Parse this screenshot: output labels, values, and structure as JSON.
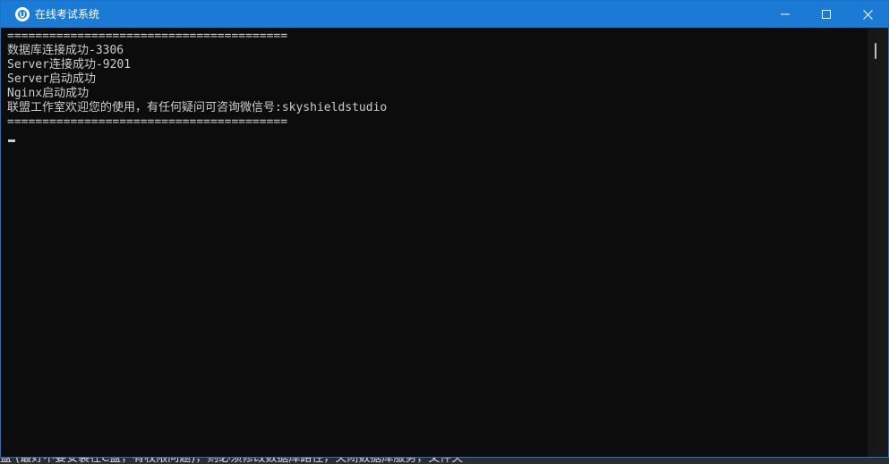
{
  "window": {
    "title": "在线考试系统"
  },
  "console": {
    "lines": [
      "========================================",
      "数据库连接成功-3306",
      "Server连接成功-9201",
      "Server启动成功",
      "Nginx启动成功",
      "联盟工作室欢迎您的使用，有任何疑问可咨询微信号:skyshieldstudio",
      "========================================"
    ]
  },
  "background": {
    "bottom_text": "盘 (最好不要安装在C盘，有权限问题)，则必须修改数据库路径，关闭数据库服务，文件夹"
  },
  "icons": {
    "app": "app-logo-icon",
    "minimize": "minimize-icon",
    "maximize": "maximize-icon",
    "close": "close-icon"
  },
  "colors": {
    "titlebar": "#1a7ad4",
    "console_bg": "#0c0c0c",
    "console_text": "#cccccc"
  }
}
